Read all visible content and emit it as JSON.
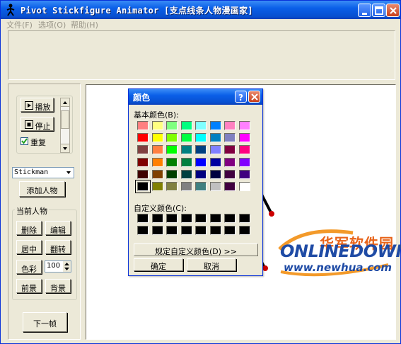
{
  "window": {
    "title": "Pivot Stickfigure Animator [支点线条人物漫画家]"
  },
  "menu": [
    "文件(F)",
    "选项(O)",
    "帮助(H)"
  ],
  "controls": {
    "play_label": "播放",
    "stop_label": "停止",
    "repeat_label": "重复",
    "repeat_checked": true,
    "figure_select_value": "Stickman",
    "add_figure_label": "添加人物"
  },
  "current_figure": {
    "group_title": "当前人物",
    "delete_label": "删除",
    "edit_label": "编辑",
    "center_label": "居中",
    "flip_label": "翻转",
    "color_label": "色彩",
    "color_value": "100",
    "front_label": "前景",
    "back_label": "背景"
  },
  "next_frame_label": "下一帧",
  "color_dialog": {
    "title": "颜色",
    "basic_colors_label": "基本颜色(B):",
    "custom_colors_label": "自定义颜色(C):",
    "define_custom_label": "规定自定义颜色(D) >>",
    "ok_label": "确定",
    "cancel_label": "取消",
    "basic_colors": [
      [
        "#ff8080",
        "#ffff80",
        "#80ff80",
        "#00ff80",
        "#80ffff",
        "#0080ff",
        "#ff80c0",
        "#ff80ff"
      ],
      [
        "#ff0000",
        "#ffff00",
        "#80ff00",
        "#00ff40",
        "#00ffff",
        "#0080c0",
        "#8080c0",
        "#ff00ff"
      ],
      [
        "#804040",
        "#ff8040",
        "#00ff00",
        "#008080",
        "#004080",
        "#8080ff",
        "#800040",
        "#ff0080"
      ],
      [
        "#800000",
        "#ff8000",
        "#008000",
        "#008040",
        "#0000ff",
        "#0000a0",
        "#800080",
        "#8000ff"
      ],
      [
        "#400000",
        "#804000",
        "#004000",
        "#004040",
        "#000080",
        "#000040",
        "#400040",
        "#400080"
      ],
      [
        "#000000",
        "#808000",
        "#808040",
        "#808080",
        "#408080",
        "#c0c0c0",
        "#400040",
        "#ffffff"
      ]
    ],
    "custom_colors": [
      [
        "#000000",
        "#000000",
        "#000000",
        "#000000",
        "#000000",
        "#000000",
        "#000000",
        "#000000"
      ],
      [
        "#000000",
        "#000000",
        "#000000",
        "#000000",
        "#000000",
        "#000000",
        "#000000",
        "#000000"
      ]
    ]
  },
  "watermark": {
    "cn_text": "华军软件园",
    "logo_text": "ONLINEDOWN",
    "url_text": "www.newhua.com"
  }
}
